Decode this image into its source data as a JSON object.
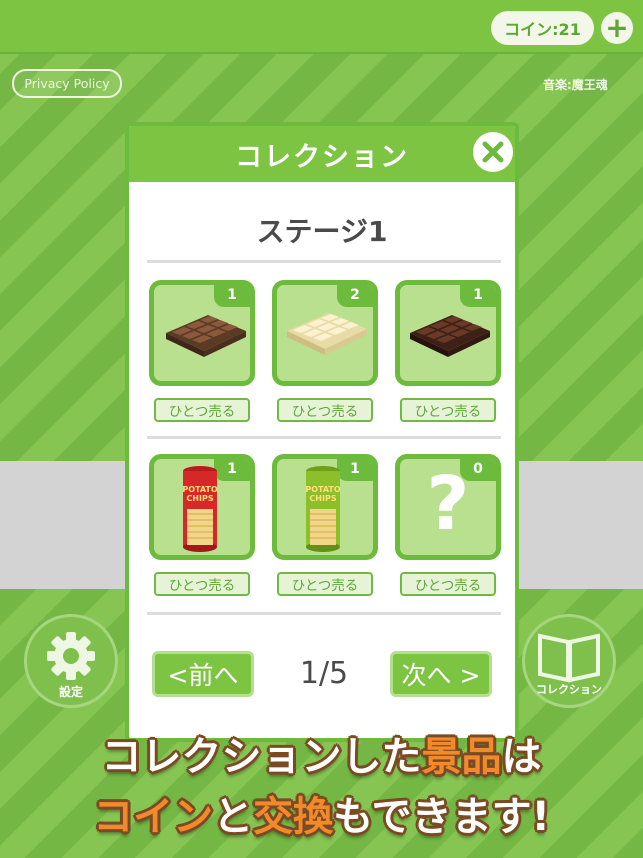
{
  "header": {
    "coin_label": "コイン:21",
    "plus": "+"
  },
  "top": {
    "privacy": "Privacy Policy",
    "music_credit": "音楽:魔王魂"
  },
  "side_buttons": {
    "settings_label": "設定",
    "collection_label": "コレクション"
  },
  "modal": {
    "title": "コレクション",
    "stage_title": "ステージ1",
    "items": [
      {
        "count": "1",
        "sell_label": "ひとつ売る",
        "icon": "milk-chocolate-icon"
      },
      {
        "count": "2",
        "sell_label": "ひとつ売る",
        "icon": "white-chocolate-icon"
      },
      {
        "count": "1",
        "sell_label": "ひとつ売る",
        "icon": "dark-chocolate-icon"
      },
      {
        "count": "1",
        "sell_label": "ひとつ売る",
        "icon": "red-potato-chips-icon"
      },
      {
        "count": "1",
        "sell_label": "ひとつ売る",
        "icon": "green-potato-chips-icon"
      },
      {
        "count": "0",
        "sell_label": "ひとつ売る",
        "icon": "unknown-question-icon"
      }
    ],
    "chips_text_line1": "POTATO",
    "chips_text_line2": "CHIPS",
    "unknown_mark": "?",
    "prev_label": "<前へ",
    "next_label": "次へ >",
    "page_indicator": "1/5"
  },
  "promo": {
    "line1_a": "コレクションした",
    "line1_b": "景品",
    "line1_c": "は",
    "line2_a": "コイン",
    "line2_b": "と",
    "line2_c": "交換",
    "line2_d": "もできます!"
  },
  "colors": {
    "accent_green": "#7ec443",
    "promo_orange": "#f28a2c"
  }
}
